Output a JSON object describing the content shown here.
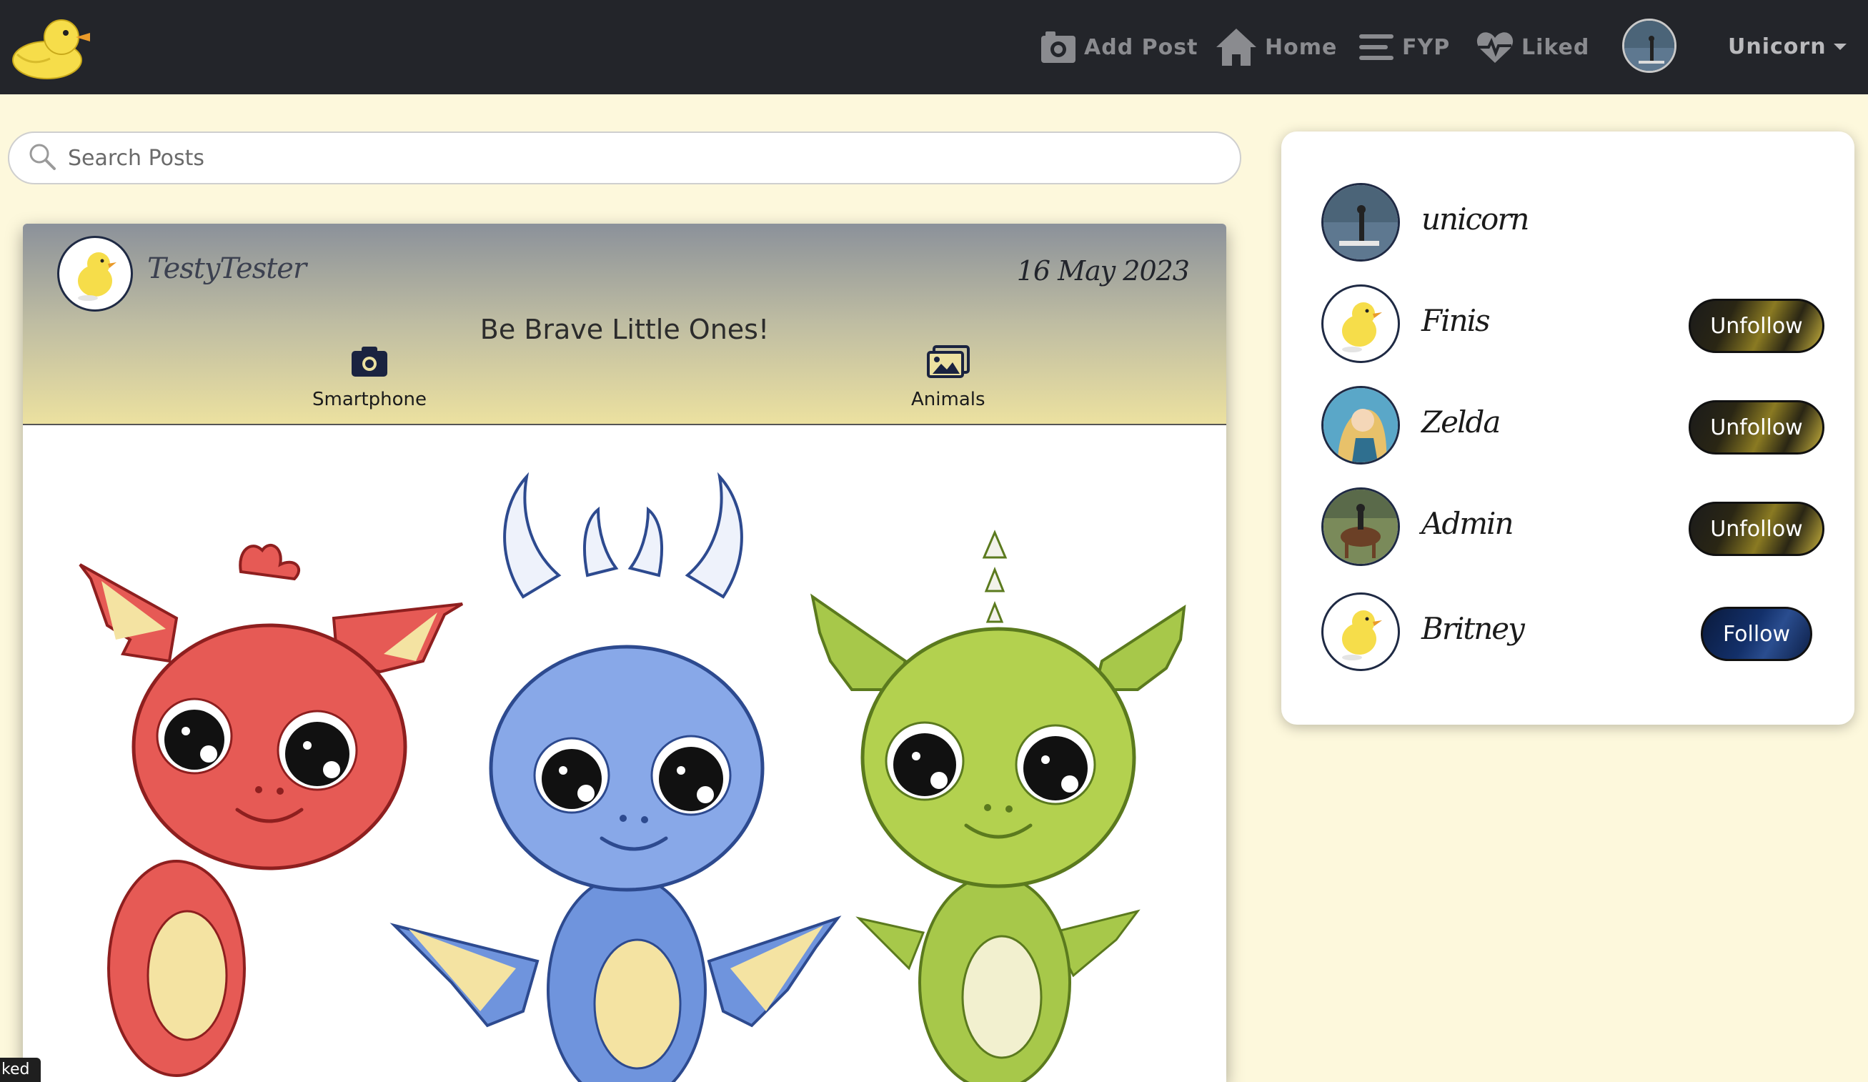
{
  "nav": {
    "logo_icon": "duck-icon",
    "items": [
      {
        "label": "Add Post",
        "icon": "camera-icon"
      },
      {
        "label": "Home",
        "icon": "home-icon"
      },
      {
        "label": "FYP",
        "icon": "bars-icon"
      },
      {
        "label": "Liked",
        "icon": "heart-pulse-icon"
      }
    ],
    "user_name": "Unicorn"
  },
  "search": {
    "placeholder": "Search Posts"
  },
  "post": {
    "author": "TestyTester",
    "date": "16 May 2023",
    "title": "Be Brave Little Ones!",
    "tags": [
      {
        "label": "Smartphone",
        "icon": "camera-icon"
      },
      {
        "label": "Animals",
        "icon": "images-icon"
      }
    ],
    "image": "three-baby-dragons-illustration"
  },
  "sidebar": {
    "users": [
      {
        "name": "unicorn",
        "action": ""
      },
      {
        "name": "Finis",
        "action": "Unfollow"
      },
      {
        "name": "Zelda",
        "action": "Unfollow"
      },
      {
        "name": "Admin",
        "action": "Unfollow"
      },
      {
        "name": "Britney",
        "action": "Follow"
      }
    ]
  },
  "tooltip": {
    "text": "ked"
  },
  "colors": {
    "nav_bg": "#23252a",
    "page_bg": "#fdf8dc",
    "follow": "#13306a",
    "unfollow": "#8a7a22"
  }
}
